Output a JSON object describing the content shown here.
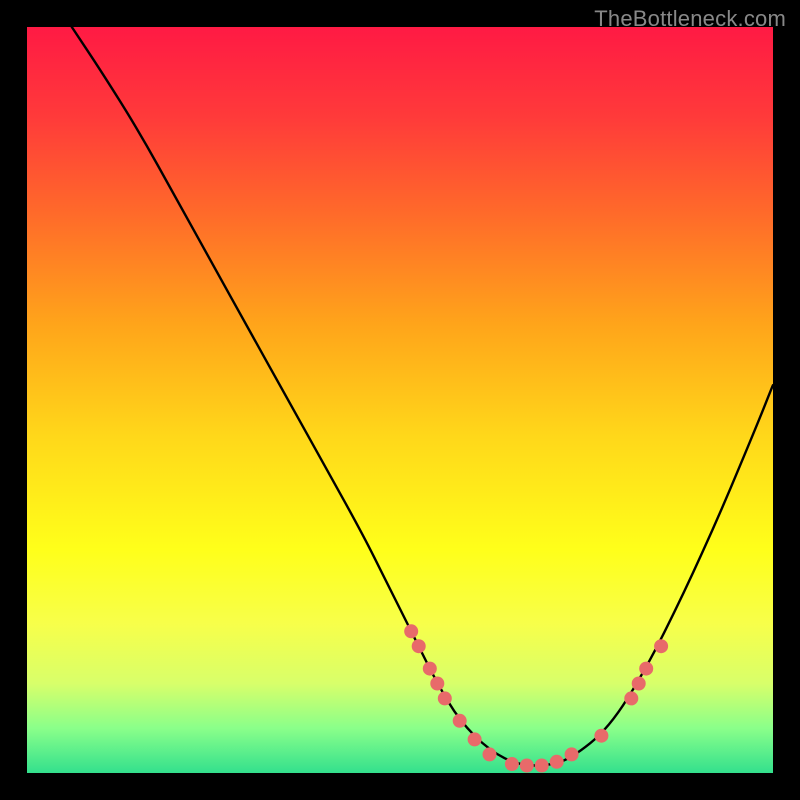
{
  "watermark": "TheBottleneck.com",
  "chart_data": {
    "type": "line",
    "title": "",
    "xlabel": "",
    "ylabel": "",
    "xlim": [
      0,
      100
    ],
    "ylim": [
      0,
      100
    ],
    "grid": false,
    "legend": false,
    "series": [
      {
        "name": "bottleneck-curve",
        "x": [
          6,
          10,
          15,
          20,
          25,
          30,
          35,
          40,
          45,
          48,
          52,
          55,
          58,
          62,
          66,
          70,
          73,
          78,
          83,
          88,
          93,
          98,
          100
        ],
        "y": [
          100,
          94,
          86,
          77,
          68,
          59,
          50,
          41,
          32,
          26,
          18,
          12,
          7,
          3,
          1,
          1,
          2,
          6,
          14,
          24,
          35,
          47,
          52
        ],
        "color": "#000000"
      }
    ],
    "markers": [
      {
        "x": 51.5,
        "y": 19
      },
      {
        "x": 52.5,
        "y": 17
      },
      {
        "x": 54,
        "y": 14
      },
      {
        "x": 55,
        "y": 12
      },
      {
        "x": 56,
        "y": 10
      },
      {
        "x": 58,
        "y": 7
      },
      {
        "x": 60,
        "y": 4.5
      },
      {
        "x": 62,
        "y": 2.5
      },
      {
        "x": 65,
        "y": 1.2
      },
      {
        "x": 67,
        "y": 1
      },
      {
        "x": 69,
        "y": 1
      },
      {
        "x": 71,
        "y": 1.5
      },
      {
        "x": 73,
        "y": 2.5
      },
      {
        "x": 77,
        "y": 5
      },
      {
        "x": 81,
        "y": 10
      },
      {
        "x": 82,
        "y": 12
      },
      {
        "x": 83,
        "y": 14
      },
      {
        "x": 85,
        "y": 17
      }
    ],
    "marker_color": "#e86a6a",
    "marker_radius": 7
  }
}
